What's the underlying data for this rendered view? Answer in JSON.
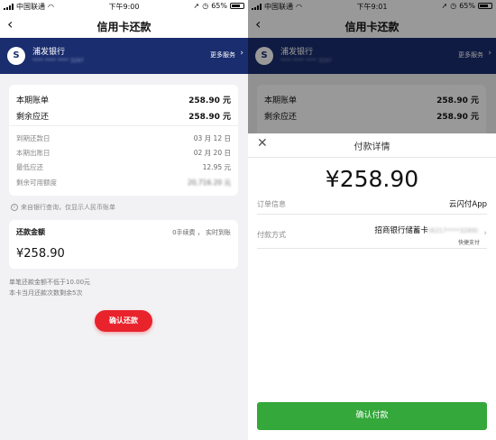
{
  "left": {
    "status": {
      "carrier": "中国联通",
      "time": "下午9:00",
      "battery": "65%"
    },
    "nav": {
      "title": "信用卡还款"
    },
    "bank": {
      "name": "浦发银行",
      "card_masked": "****  ****  ****  3297",
      "more_services": "更多服务"
    },
    "bill": {
      "current_bill_label": "本期账单",
      "current_bill_value": "258.90 元",
      "remaining_due_label": "剩余应还",
      "remaining_due_value": "258.90 元",
      "due_date_label": "到期还款日",
      "due_date_value": "03 月 12 日",
      "bill_date_label": "本期出账日",
      "bill_date_value": "02 月 20 日",
      "min_pay_label": "最低应还",
      "min_pay_value": "12.95 元",
      "avail_credit_label": "剩余可用额度",
      "avail_credit_value": "20,716.20 元"
    },
    "note": "来自银行查询，仅显示人民币账单",
    "repay": {
      "label": "还款金额",
      "fee": "0手续费 ， 实时到账",
      "amount": "¥258.90"
    },
    "hints": [
      "单笔还款金额不低于10.00元",
      "本卡当月还款次数剩余5次"
    ],
    "confirm_label": "确认还款"
  },
  "right": {
    "status": {
      "carrier": "中国联通",
      "time": "下午9:01",
      "battery": "65%"
    },
    "nav": {
      "title": "信用卡还款"
    },
    "bank": {
      "name": "浦发银行",
      "card_masked": "****  ****  ****  3297",
      "more_services": "更多服务"
    },
    "bill": {
      "current_bill_label": "本期账单",
      "current_bill_value": "258.90 元",
      "remaining_due_label": "剩余应还",
      "remaining_due_value": "258.90 元"
    },
    "sheet": {
      "title": "付款详情",
      "amount": "¥258.90",
      "order_label": "订单信息",
      "order_value": "云闪付App",
      "method_label": "付款方式",
      "method_value": "招商银行储蓄卡",
      "method_masked": "(6217****3289)",
      "method_sub": "快捷支付",
      "confirm_label": "确认付款"
    }
  },
  "colors": {
    "bank_blue": "#1a2d6e",
    "confirm_red": "#e8232c",
    "confirm_green": "#34a83b"
  }
}
